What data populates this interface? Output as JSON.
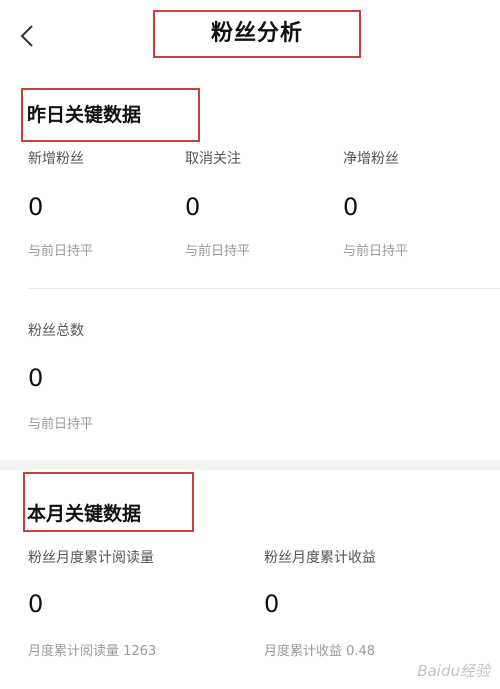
{
  "header": {
    "title": "粉丝分析"
  },
  "yesterday": {
    "title": "昨日关键数据",
    "metrics": [
      {
        "label": "新增粉丝",
        "value": "0",
        "note": "与前日持平"
      },
      {
        "label": "取消关注",
        "value": "0",
        "note": "与前日持平"
      },
      {
        "label": "净增粉丝",
        "value": "0",
        "note": "与前日持平"
      }
    ],
    "total": {
      "label": "粉丝总数",
      "value": "0",
      "note": "与前日持平"
    }
  },
  "month": {
    "title": "本月关键数据",
    "metrics": [
      {
        "label": "粉丝月度累计阅读量",
        "value": "0",
        "note": "月度累计阅读量 1263"
      },
      {
        "label": "粉丝月度累计收益",
        "value": "0",
        "note": "月度累计收益 0.48"
      }
    ]
  },
  "watermark": "Baidu经验",
  "colors": {
    "highlight_box": "#d33b3b",
    "muted_text": "#9a9a9a"
  },
  "icons": {
    "back": "chevron-left-icon"
  }
}
